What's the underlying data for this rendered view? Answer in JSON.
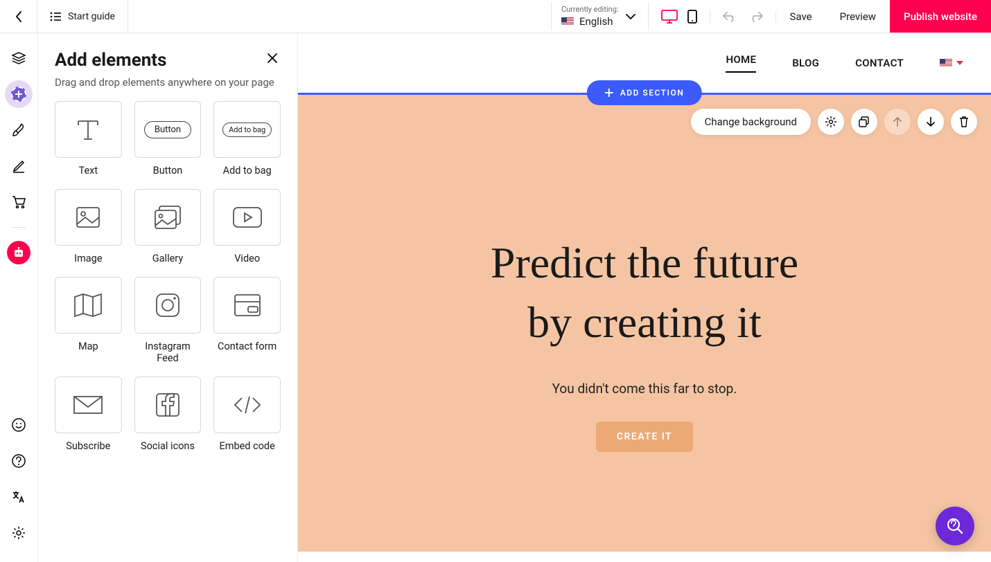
{
  "topbar": {
    "start_guide": "Start guide",
    "currently_editing_label": "Currently editing:",
    "language": "English",
    "save": "Save",
    "preview": "Preview",
    "publish": "Publish website"
  },
  "panel": {
    "title": "Add elements",
    "subtitle": "Drag and drop elements anywhere on your page",
    "elements": [
      {
        "label": "Text"
      },
      {
        "label": "Button",
        "pill": "Button"
      },
      {
        "label": "Add to bag",
        "pill": "Add to bag"
      },
      {
        "label": "Image"
      },
      {
        "label": "Gallery"
      },
      {
        "label": "Video"
      },
      {
        "label": "Map"
      },
      {
        "label": "Instagram Feed"
      },
      {
        "label": "Contact form"
      },
      {
        "label": "Subscribe"
      },
      {
        "label": "Social icons"
      },
      {
        "label": "Embed code"
      }
    ]
  },
  "site": {
    "nav": {
      "home": "HOME",
      "blog": "BLOG",
      "contact": "CONTACT"
    },
    "add_section": "ADD SECTION",
    "toolbar": {
      "change_bg": "Change background"
    },
    "hero": {
      "heading_line1": "Predict the future",
      "heading_line2": "by creating it",
      "subtitle": "You didn't come this far to stop.",
      "cta": "CREATE IT"
    }
  }
}
